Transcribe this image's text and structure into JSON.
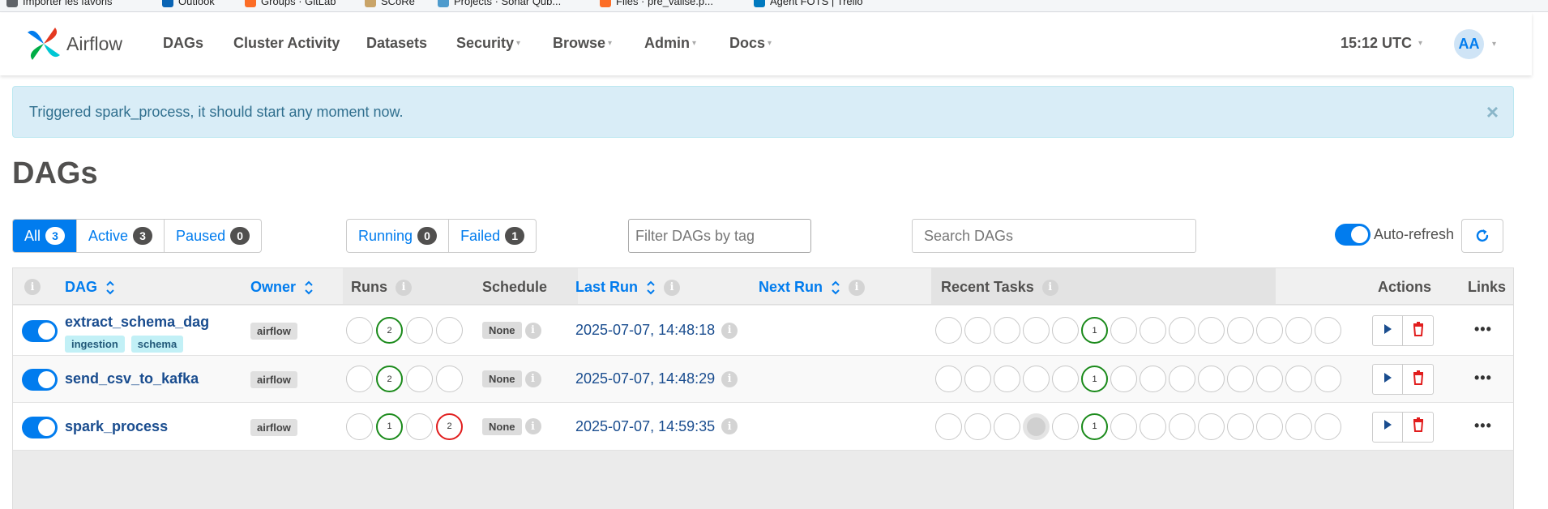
{
  "bookmarks": [
    {
      "label": "Importer les favoris",
      "color": "#5f6368"
    },
    {
      "label": "Outlook",
      "color": "#0a64b4"
    },
    {
      "label": "Groups · GitLab",
      "color": "#fc6d26"
    },
    {
      "label": "SCoRe",
      "color": "#c9a468"
    },
    {
      "label": "Projects · Sonar Qub...",
      "color": "#4e9bcd"
    },
    {
      "label": "Files · pre_valise.p...",
      "color": "#fc6d26"
    },
    {
      "label": "Agent FOTS | Trello",
      "color": "#0079bf"
    }
  ],
  "navbar": {
    "brand": "Airflow",
    "items": [
      {
        "label": "DAGs",
        "caret": ""
      },
      {
        "label": "Cluster Activity",
        "caret": ""
      },
      {
        "label": "Datasets",
        "caret": ""
      },
      {
        "label": "Security",
        "caret": "▾"
      },
      {
        "label": "Browse",
        "caret": "▾"
      },
      {
        "label": "Admin",
        "caret": "▾"
      },
      {
        "label": "Docs",
        "caret": "▾"
      }
    ],
    "clock": "15:12 UTC",
    "avatar": "AA",
    "caret": "▾"
  },
  "alert": {
    "message": "Triggered spark_process, it should start any moment now.",
    "close": "×"
  },
  "page_title": "DAGs",
  "status_filter": [
    {
      "label": "All",
      "count": "3",
      "active": true
    },
    {
      "label": "Active",
      "count": "3",
      "active": false
    },
    {
      "label": "Paused",
      "count": "0",
      "active": false
    }
  ],
  "run_filter": [
    {
      "label": "Running",
      "count": "0"
    },
    {
      "label": "Failed",
      "count": "1"
    }
  ],
  "tag_filter": {
    "placeholder": "Filter DAGs by tag"
  },
  "search": {
    "placeholder": "Search DAGs"
  },
  "auto_refresh": {
    "label": "Auto-refresh",
    "on": true
  },
  "table": {
    "info": "i",
    "headers": {
      "dag": "DAG",
      "owner": "Owner",
      "runs": "Runs",
      "schedule": "Schedule",
      "last_run": "Last Run",
      "next_run": "Next Run",
      "recent_tasks": "Recent Tasks",
      "actions": "Actions",
      "links": "Links"
    },
    "rows": [
      {
        "dag_id": "extract_schema_dag",
        "tags": [
          "ingestion",
          "schema"
        ],
        "owner": "airflow",
        "runs": [
          {
            "state": "none",
            "count": ""
          },
          {
            "state": "success",
            "count": "2"
          },
          {
            "state": "none",
            "count": ""
          },
          {
            "state": "none",
            "count": ""
          }
        ],
        "schedule": "None",
        "last_run": "2025-07-07, 14:48:18",
        "recent_tasks": [
          {
            "state": "none",
            "count": ""
          },
          {
            "state": "none",
            "count": ""
          },
          {
            "state": "none",
            "count": ""
          },
          {
            "state": "none",
            "count": ""
          },
          {
            "state": "none",
            "count": ""
          },
          {
            "state": "success",
            "count": "1"
          },
          {
            "state": "none",
            "count": ""
          },
          {
            "state": "none",
            "count": ""
          },
          {
            "state": "none",
            "count": ""
          },
          {
            "state": "none",
            "count": ""
          },
          {
            "state": "none",
            "count": ""
          },
          {
            "state": "none",
            "count": ""
          },
          {
            "state": "none",
            "count": ""
          },
          {
            "state": "none",
            "count": ""
          }
        ],
        "links": "•••"
      },
      {
        "dag_id": "send_csv_to_kafka",
        "tags": [],
        "owner": "airflow",
        "runs": [
          {
            "state": "none",
            "count": ""
          },
          {
            "state": "success",
            "count": "2"
          },
          {
            "state": "none",
            "count": ""
          },
          {
            "state": "none",
            "count": ""
          }
        ],
        "schedule": "None",
        "last_run": "2025-07-07, 14:48:29",
        "recent_tasks": [
          {
            "state": "none",
            "count": ""
          },
          {
            "state": "none",
            "count": ""
          },
          {
            "state": "none",
            "count": ""
          },
          {
            "state": "none",
            "count": ""
          },
          {
            "state": "none",
            "count": ""
          },
          {
            "state": "success",
            "count": "1"
          },
          {
            "state": "none",
            "count": ""
          },
          {
            "state": "none",
            "count": ""
          },
          {
            "state": "none",
            "count": ""
          },
          {
            "state": "none",
            "count": ""
          },
          {
            "state": "none",
            "count": ""
          },
          {
            "state": "none",
            "count": ""
          },
          {
            "state": "none",
            "count": ""
          },
          {
            "state": "none",
            "count": ""
          }
        ],
        "links": "•••"
      },
      {
        "dag_id": "spark_process",
        "tags": [],
        "owner": "airflow",
        "runs": [
          {
            "state": "none",
            "count": ""
          },
          {
            "state": "success",
            "count": "1"
          },
          {
            "state": "none",
            "count": ""
          },
          {
            "state": "failed",
            "count": "2"
          }
        ],
        "schedule": "None",
        "last_run": "2025-07-07, 14:59:35",
        "recent_tasks": [
          {
            "state": "none",
            "count": ""
          },
          {
            "state": "none",
            "count": ""
          },
          {
            "state": "none",
            "count": ""
          },
          {
            "state": "queued",
            "count": ""
          },
          {
            "state": "none",
            "count": ""
          },
          {
            "state": "success",
            "count": "1"
          },
          {
            "state": "none",
            "count": ""
          },
          {
            "state": "none",
            "count": ""
          },
          {
            "state": "none",
            "count": ""
          },
          {
            "state": "none",
            "count": ""
          },
          {
            "state": "none",
            "count": ""
          },
          {
            "state": "none",
            "count": ""
          },
          {
            "state": "none",
            "count": ""
          },
          {
            "state": "none",
            "count": ""
          }
        ],
        "links": "•••"
      }
    ]
  },
  "colors": {
    "primary": "#017cee",
    "success": "#1a8a1a",
    "failed": "#e11d1d",
    "alert_bg": "#d9edf7"
  }
}
